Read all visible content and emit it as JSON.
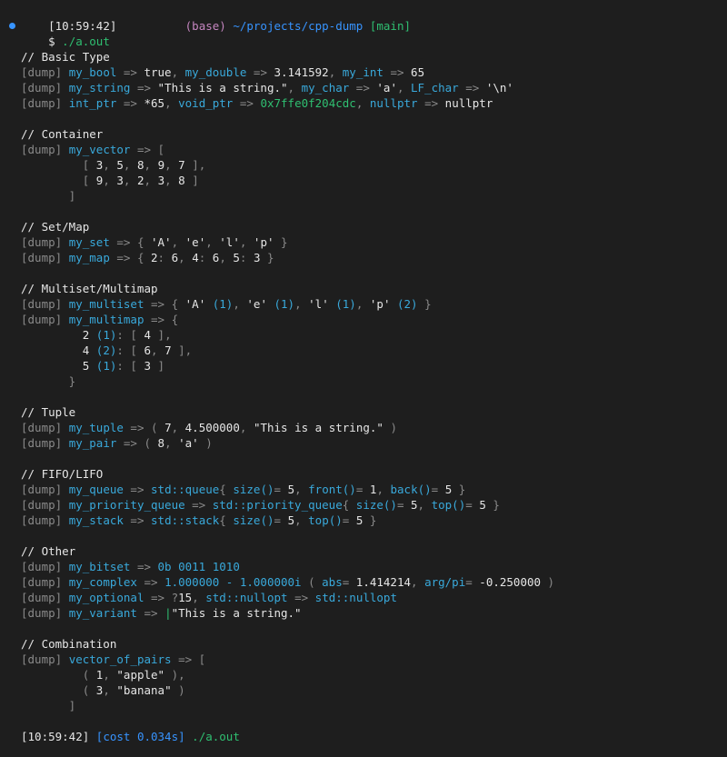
{
  "theme": {
    "background": "#1e1e1e",
    "text": "#e6e6e6",
    "dim": "#8a8a8a",
    "magenta": "#c586c0",
    "blue": "#3794ff",
    "cyan": "#39a9db",
    "green": "#2fbf71",
    "yellow": "#cccc55"
  },
  "prompt": {
    "time": "[10:59:42]",
    "env": "(base)",
    "path": "~/projects/cpp-dump",
    "branch": "[main]",
    "command_symbol": "$",
    "command": "./a.out"
  },
  "lines": [
    [
      [
        "// Basic Type",
        "white"
      ]
    ],
    [
      [
        "[dump] ",
        "dim"
      ],
      [
        "my_bool",
        "cyan"
      ],
      [
        " => ",
        "dim"
      ],
      [
        "true",
        "white"
      ],
      [
        ", ",
        "dim"
      ],
      [
        "my_double",
        "cyan"
      ],
      [
        " => ",
        "dim"
      ],
      [
        "3.141592",
        "white"
      ],
      [
        ", ",
        "dim"
      ],
      [
        "my_int",
        "cyan"
      ],
      [
        " => ",
        "dim"
      ],
      [
        "65",
        "white"
      ]
    ],
    [
      [
        "[dump] ",
        "dim"
      ],
      [
        "my_string",
        "cyan"
      ],
      [
        " => ",
        "dim"
      ],
      [
        "\"This is a string.\"",
        "white"
      ],
      [
        ", ",
        "dim"
      ],
      [
        "my_char",
        "cyan"
      ],
      [
        " => ",
        "dim"
      ],
      [
        "'a'",
        "white"
      ],
      [
        ", ",
        "dim"
      ],
      [
        "LF_char",
        "cyan"
      ],
      [
        " => ",
        "dim"
      ],
      [
        "'\\n'",
        "white"
      ]
    ],
    [
      [
        "[dump] ",
        "dim"
      ],
      [
        "int_ptr",
        "cyan"
      ],
      [
        " => ",
        "dim"
      ],
      [
        "*65",
        "white"
      ],
      [
        ", ",
        "dim"
      ],
      [
        "void_ptr",
        "cyan"
      ],
      [
        " => ",
        "dim"
      ],
      [
        "0x7ffe0f204cdc",
        "green"
      ],
      [
        ", ",
        "dim"
      ],
      [
        "nullptr",
        "cyan"
      ],
      [
        " => ",
        "dim"
      ],
      [
        "nullptr",
        "white"
      ]
    ],
    [],
    [
      [
        "// Container",
        "white"
      ]
    ],
    [
      [
        "[dump] ",
        "dim"
      ],
      [
        "my_vector",
        "cyan"
      ],
      [
        " => [",
        "dim"
      ]
    ],
    [
      [
        "         [ ",
        "dim"
      ],
      [
        "3",
        "white"
      ],
      [
        ", ",
        "dim"
      ],
      [
        "5",
        "white"
      ],
      [
        ", ",
        "dim"
      ],
      [
        "8",
        "white"
      ],
      [
        ", ",
        "dim"
      ],
      [
        "9",
        "white"
      ],
      [
        ", ",
        "dim"
      ],
      [
        "7",
        "white"
      ],
      [
        " ],",
        "dim"
      ]
    ],
    [
      [
        "         [ ",
        "dim"
      ],
      [
        "9",
        "white"
      ],
      [
        ", ",
        "dim"
      ],
      [
        "3",
        "white"
      ],
      [
        ", ",
        "dim"
      ],
      [
        "2",
        "white"
      ],
      [
        ", ",
        "dim"
      ],
      [
        "3",
        "white"
      ],
      [
        ", ",
        "dim"
      ],
      [
        "8",
        "white"
      ],
      [
        " ]",
        "dim"
      ]
    ],
    [
      [
        "       ]",
        "dim"
      ]
    ],
    [],
    [
      [
        "// Set/Map",
        "white"
      ]
    ],
    [
      [
        "[dump] ",
        "dim"
      ],
      [
        "my_set",
        "cyan"
      ],
      [
        " => { ",
        "dim"
      ],
      [
        "'A'",
        "white"
      ],
      [
        ", ",
        "dim"
      ],
      [
        "'e'",
        "white"
      ],
      [
        ", ",
        "dim"
      ],
      [
        "'l'",
        "white"
      ],
      [
        ", ",
        "dim"
      ],
      [
        "'p'",
        "white"
      ],
      [
        " }",
        "dim"
      ]
    ],
    [
      [
        "[dump] ",
        "dim"
      ],
      [
        "my_map",
        "cyan"
      ],
      [
        " => { ",
        "dim"
      ],
      [
        "2",
        "white"
      ],
      [
        ": ",
        "dim"
      ],
      [
        "6",
        "white"
      ],
      [
        ", ",
        "dim"
      ],
      [
        "4",
        "white"
      ],
      [
        ": ",
        "dim"
      ],
      [
        "6",
        "white"
      ],
      [
        ", ",
        "dim"
      ],
      [
        "5",
        "white"
      ],
      [
        ": ",
        "dim"
      ],
      [
        "3",
        "white"
      ],
      [
        " }",
        "dim"
      ]
    ],
    [],
    [
      [
        "// Multiset/Multimap",
        "white"
      ]
    ],
    [
      [
        "[dump] ",
        "dim"
      ],
      [
        "my_multiset",
        "cyan"
      ],
      [
        " => { ",
        "dim"
      ],
      [
        "'A'",
        "white"
      ],
      [
        " (1)",
        "cyan"
      ],
      [
        ", ",
        "dim"
      ],
      [
        "'e'",
        "white"
      ],
      [
        " (1)",
        "cyan"
      ],
      [
        ", ",
        "dim"
      ],
      [
        "'l'",
        "white"
      ],
      [
        " (1)",
        "cyan"
      ],
      [
        ", ",
        "dim"
      ],
      [
        "'p'",
        "white"
      ],
      [
        " (2)",
        "cyan"
      ],
      [
        " }",
        "dim"
      ]
    ],
    [
      [
        "[dump] ",
        "dim"
      ],
      [
        "my_multimap",
        "cyan"
      ],
      [
        " => {",
        "dim"
      ]
    ],
    [
      [
        "         ",
        "dim"
      ],
      [
        "2",
        "white"
      ],
      [
        " (1)",
        "cyan"
      ],
      [
        ": [ ",
        "dim"
      ],
      [
        "4",
        "white"
      ],
      [
        " ],",
        "dim"
      ]
    ],
    [
      [
        "         ",
        "dim"
      ],
      [
        "4",
        "white"
      ],
      [
        " (2)",
        "cyan"
      ],
      [
        ": [ ",
        "dim"
      ],
      [
        "6",
        "white"
      ],
      [
        ", ",
        "dim"
      ],
      [
        "7",
        "white"
      ],
      [
        " ],",
        "dim"
      ]
    ],
    [
      [
        "         ",
        "dim"
      ],
      [
        "5",
        "white"
      ],
      [
        " (1)",
        "cyan"
      ],
      [
        ": [ ",
        "dim"
      ],
      [
        "3",
        "white"
      ],
      [
        " ]",
        "dim"
      ]
    ],
    [
      [
        "       }",
        "dim"
      ]
    ],
    [],
    [
      [
        "// Tuple",
        "white"
      ]
    ],
    [
      [
        "[dump] ",
        "dim"
      ],
      [
        "my_tuple",
        "cyan"
      ],
      [
        " => ( ",
        "dim"
      ],
      [
        "7",
        "white"
      ],
      [
        ", ",
        "dim"
      ],
      [
        "4.500000",
        "white"
      ],
      [
        ", ",
        "dim"
      ],
      [
        "\"This is a string.\"",
        "white"
      ],
      [
        " )",
        "dim"
      ]
    ],
    [
      [
        "[dump] ",
        "dim"
      ],
      [
        "my_pair",
        "cyan"
      ],
      [
        " => ( ",
        "dim"
      ],
      [
        "8",
        "white"
      ],
      [
        ", ",
        "dim"
      ],
      [
        "'a'",
        "white"
      ],
      [
        " )",
        "dim"
      ]
    ],
    [],
    [
      [
        "// FIFO/LIFO",
        "white"
      ]
    ],
    [
      [
        "[dump] ",
        "dim"
      ],
      [
        "my_queue",
        "cyan"
      ],
      [
        " => ",
        "dim"
      ],
      [
        "std::queue",
        "cyan"
      ],
      [
        "{ ",
        "dim"
      ],
      [
        "size()",
        "cyan"
      ],
      [
        "= ",
        "dim"
      ],
      [
        "5",
        "white"
      ],
      [
        ", ",
        "dim"
      ],
      [
        "front()",
        "cyan"
      ],
      [
        "= ",
        "dim"
      ],
      [
        "1",
        "white"
      ],
      [
        ", ",
        "dim"
      ],
      [
        "back()",
        "cyan"
      ],
      [
        "= ",
        "dim"
      ],
      [
        "5",
        "white"
      ],
      [
        " }",
        "dim"
      ]
    ],
    [
      [
        "[dump] ",
        "dim"
      ],
      [
        "my_priority_queue",
        "cyan"
      ],
      [
        " => ",
        "dim"
      ],
      [
        "std::priority_queue",
        "cyan"
      ],
      [
        "{ ",
        "dim"
      ],
      [
        "size()",
        "cyan"
      ],
      [
        "= ",
        "dim"
      ],
      [
        "5",
        "white"
      ],
      [
        ", ",
        "dim"
      ],
      [
        "top()",
        "cyan"
      ],
      [
        "= ",
        "dim"
      ],
      [
        "5",
        "white"
      ],
      [
        " }",
        "dim"
      ]
    ],
    [
      [
        "[dump] ",
        "dim"
      ],
      [
        "my_stack",
        "cyan"
      ],
      [
        " => ",
        "dim"
      ],
      [
        "std::stack",
        "cyan"
      ],
      [
        "{ ",
        "dim"
      ],
      [
        "size()",
        "cyan"
      ],
      [
        "= ",
        "dim"
      ],
      [
        "5",
        "white"
      ],
      [
        ", ",
        "dim"
      ],
      [
        "top()",
        "cyan"
      ],
      [
        "= ",
        "dim"
      ],
      [
        "5",
        "white"
      ],
      [
        " }",
        "dim"
      ]
    ],
    [],
    [
      [
        "// Other",
        "white"
      ]
    ],
    [
      [
        "[dump] ",
        "dim"
      ],
      [
        "my_bitset",
        "cyan"
      ],
      [
        " => ",
        "dim"
      ],
      [
        "0b 0011 1010",
        "cyan"
      ]
    ],
    [
      [
        "[dump] ",
        "dim"
      ],
      [
        "my_complex",
        "cyan"
      ],
      [
        " => ",
        "dim"
      ],
      [
        "1.000000 - 1.000000i",
        "cyan"
      ],
      [
        " ( ",
        "dim"
      ],
      [
        "abs",
        "cyan"
      ],
      [
        "= ",
        "dim"
      ],
      [
        "1.414214",
        "white"
      ],
      [
        ", ",
        "dim"
      ],
      [
        "arg/pi",
        "cyan"
      ],
      [
        "= ",
        "dim"
      ],
      [
        "-0.250000",
        "white"
      ],
      [
        " )",
        "dim"
      ]
    ],
    [
      [
        "[dump] ",
        "dim"
      ],
      [
        "my_optional",
        "cyan"
      ],
      [
        " => ",
        "dim"
      ],
      [
        "?",
        "dim"
      ],
      [
        "15",
        "white"
      ],
      [
        ", ",
        "dim"
      ],
      [
        "std::nullopt",
        "cyan"
      ],
      [
        " => ",
        "dim"
      ],
      [
        "std::nullopt",
        "cyan"
      ]
    ],
    [
      [
        "[dump] ",
        "dim"
      ],
      [
        "my_variant",
        "cyan"
      ],
      [
        " => ",
        "dim"
      ],
      [
        "|",
        "green"
      ],
      [
        "\"This is a string.\"",
        "white"
      ]
    ],
    [],
    [
      [
        "// Combination",
        "white"
      ]
    ],
    [
      [
        "[dump] ",
        "dim"
      ],
      [
        "vector_of_pairs",
        "cyan"
      ],
      [
        " => [",
        "dim"
      ]
    ],
    [
      [
        "         ( ",
        "dim"
      ],
      [
        "1",
        "white"
      ],
      [
        ", ",
        "dim"
      ],
      [
        "\"apple\"",
        "white"
      ],
      [
        " ),",
        "dim"
      ]
    ],
    [
      [
        "         ( ",
        "dim"
      ],
      [
        "3",
        "white"
      ],
      [
        ", ",
        "dim"
      ],
      [
        "\"banana\"",
        "white"
      ],
      [
        " )",
        "dim"
      ]
    ],
    [
      [
        "       ]",
        "dim"
      ]
    ],
    [],
    [
      [
        "[10:59:42] ",
        "white"
      ],
      [
        "[cost 0.034s]",
        "blue"
      ],
      [
        " ./a.out",
        "green"
      ]
    ]
  ]
}
